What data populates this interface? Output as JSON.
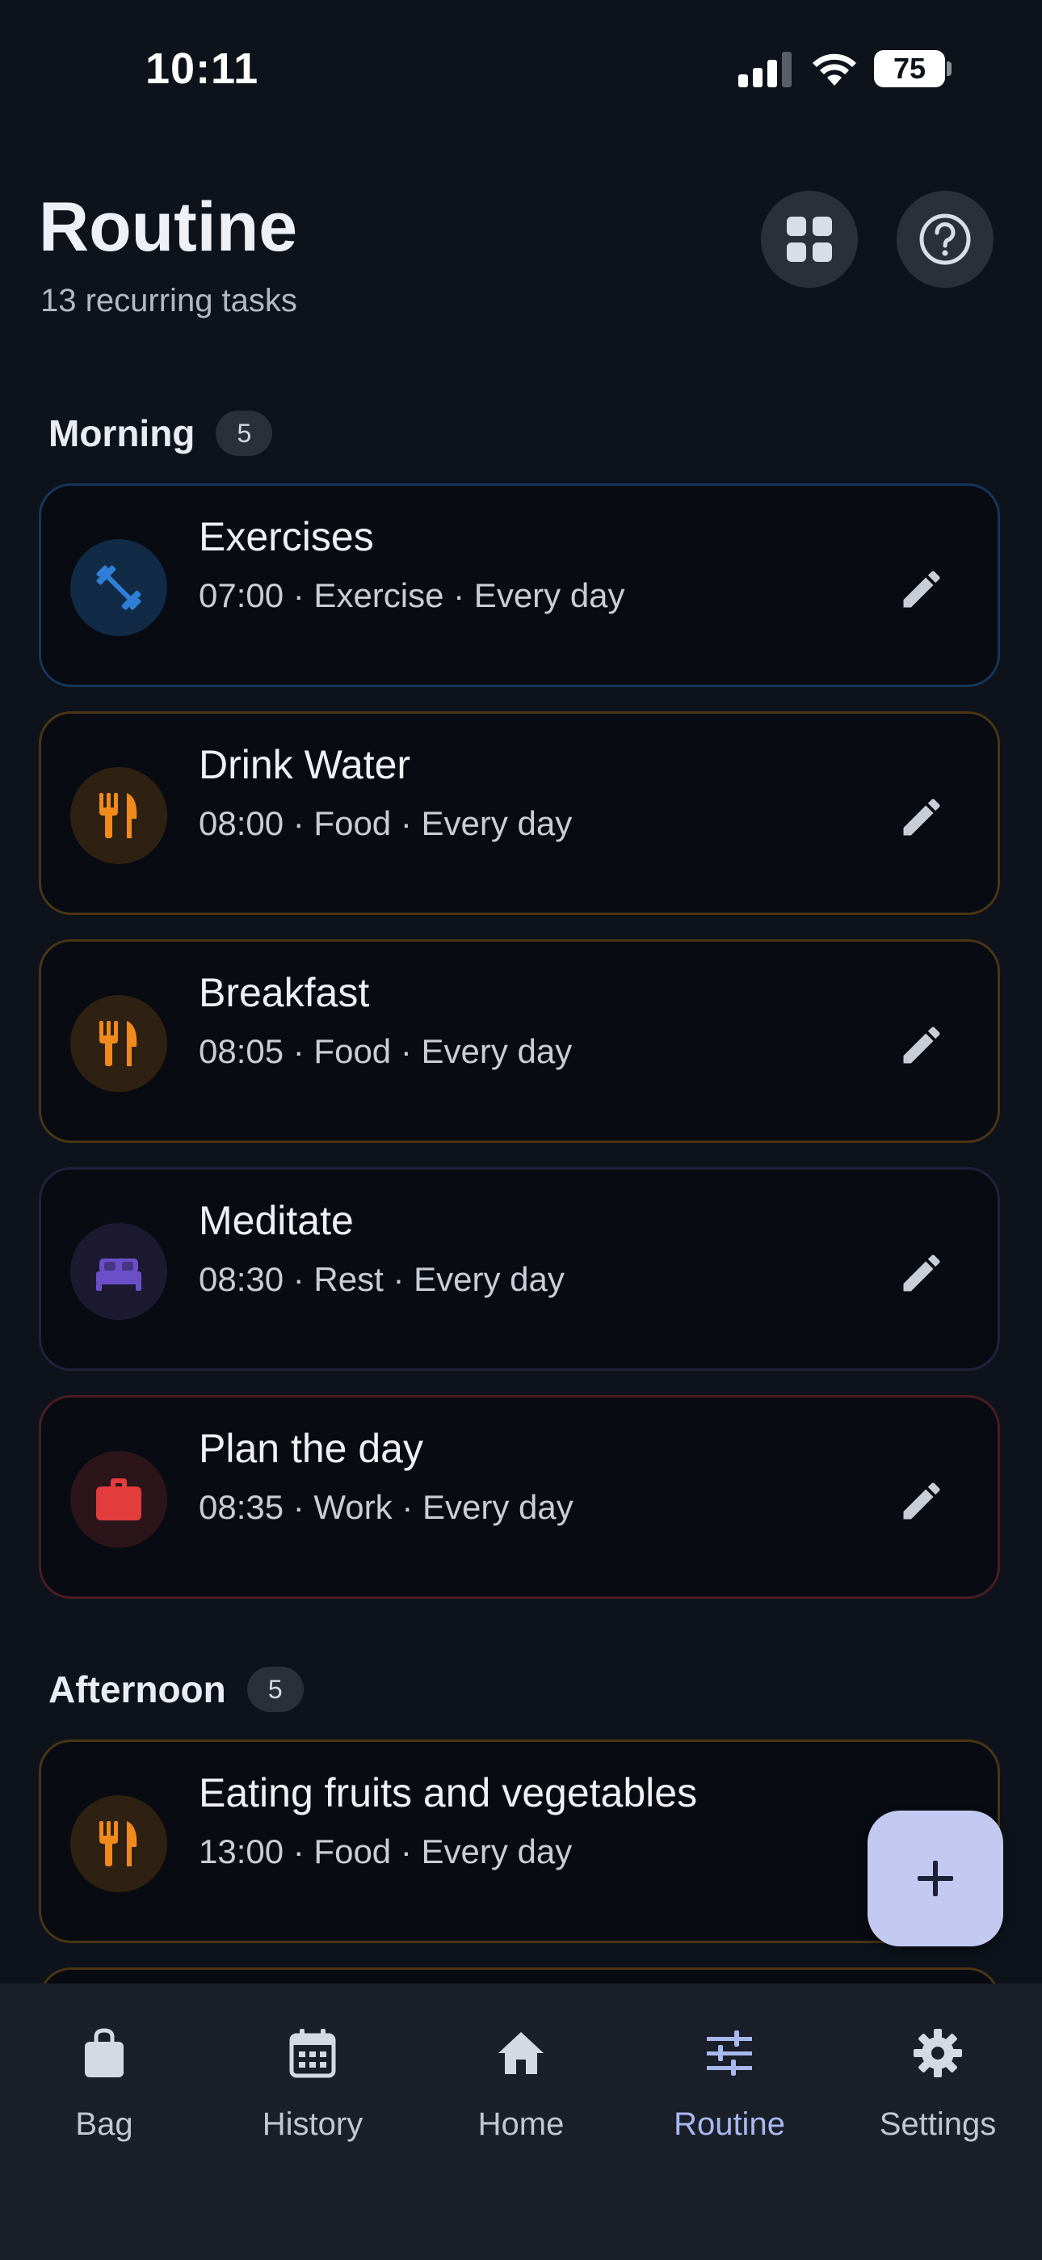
{
  "status_bar": {
    "time": "10:11",
    "battery": "75"
  },
  "header": {
    "title": "Routine",
    "subtitle": "13 recurring tasks"
  },
  "icons": {
    "grid": "grid-icon",
    "help": "help-icon",
    "edit": "pencil-icon",
    "exercise": "dumbbell-icon",
    "food": "fork-knife-icon",
    "rest": "bed-icon",
    "work": "briefcase-icon"
  },
  "sections": [
    {
      "label": "Morning",
      "count": "5",
      "tasks": [
        {
          "title": "Exercises",
          "meta": "07:00 · Exercise · Every day",
          "category": "exercise"
        },
        {
          "title": "Drink Water",
          "meta": "08:00 · Food · Every day",
          "category": "food"
        },
        {
          "title": "Breakfast",
          "meta": "08:05 · Food · Every day",
          "category": "food"
        },
        {
          "title": "Meditate",
          "meta": "08:30 · Rest · Every day",
          "category": "rest"
        },
        {
          "title": "Plan the day",
          "meta": "08:35 · Work · Every day",
          "category": "work"
        }
      ]
    },
    {
      "label": "Afternoon",
      "count": "5",
      "tasks": [
        {
          "title": "Eating fruits and vegetables",
          "meta": "13:00 · Food · Every day",
          "category": "food"
        }
      ]
    }
  ],
  "colors": {
    "exercise": "#2f7fd8",
    "food": "#f08a1c",
    "rest": "#6a4fc8",
    "work": "#e23c3c",
    "accent": "#a8b8f0"
  },
  "nav": [
    {
      "label": "Bag",
      "icon": "bag-icon"
    },
    {
      "label": "History",
      "icon": "calendar-icon"
    },
    {
      "label": "Home",
      "icon": "home-icon"
    },
    {
      "label": "Routine",
      "icon": "sliders-icon",
      "active": true
    },
    {
      "label": "Settings",
      "icon": "gear-icon"
    }
  ]
}
